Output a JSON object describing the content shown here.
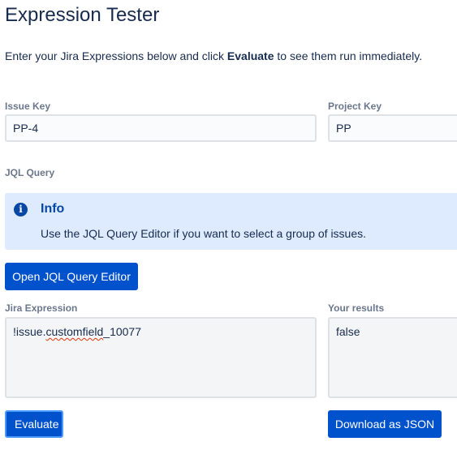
{
  "page": {
    "title": "Expression Tester",
    "intro_prefix": "Enter your Jira Expressions below and click ",
    "intro_bold": "Evaluate",
    "intro_suffix": " to see them run immediately."
  },
  "issue_key": {
    "label": "Issue Key",
    "value": "PP-4"
  },
  "project_key": {
    "label": "Project Key",
    "value": "PP"
  },
  "jql": {
    "label": "JQL Query",
    "info_icon": "info-icon",
    "info_title": "Info",
    "info_text": "Use the JQL Query Editor if you want to select a group of issues.",
    "open_editor_label": "Open JQL Query Editor"
  },
  "expression": {
    "label": "Jira Expression",
    "value_prefix": "!issue.",
    "value_misspelled": "customfield",
    "value_suffix": "_10077"
  },
  "results": {
    "label": "Your results",
    "value": "false"
  },
  "actions": {
    "evaluate_label": "Evaluate",
    "download_label": "Download as JSON"
  },
  "colors": {
    "primary_button": "#0052cc",
    "info_background": "#deebff",
    "info_accent": "#0747a6",
    "label_text": "#6b778c",
    "body_text": "#172b4d"
  }
}
